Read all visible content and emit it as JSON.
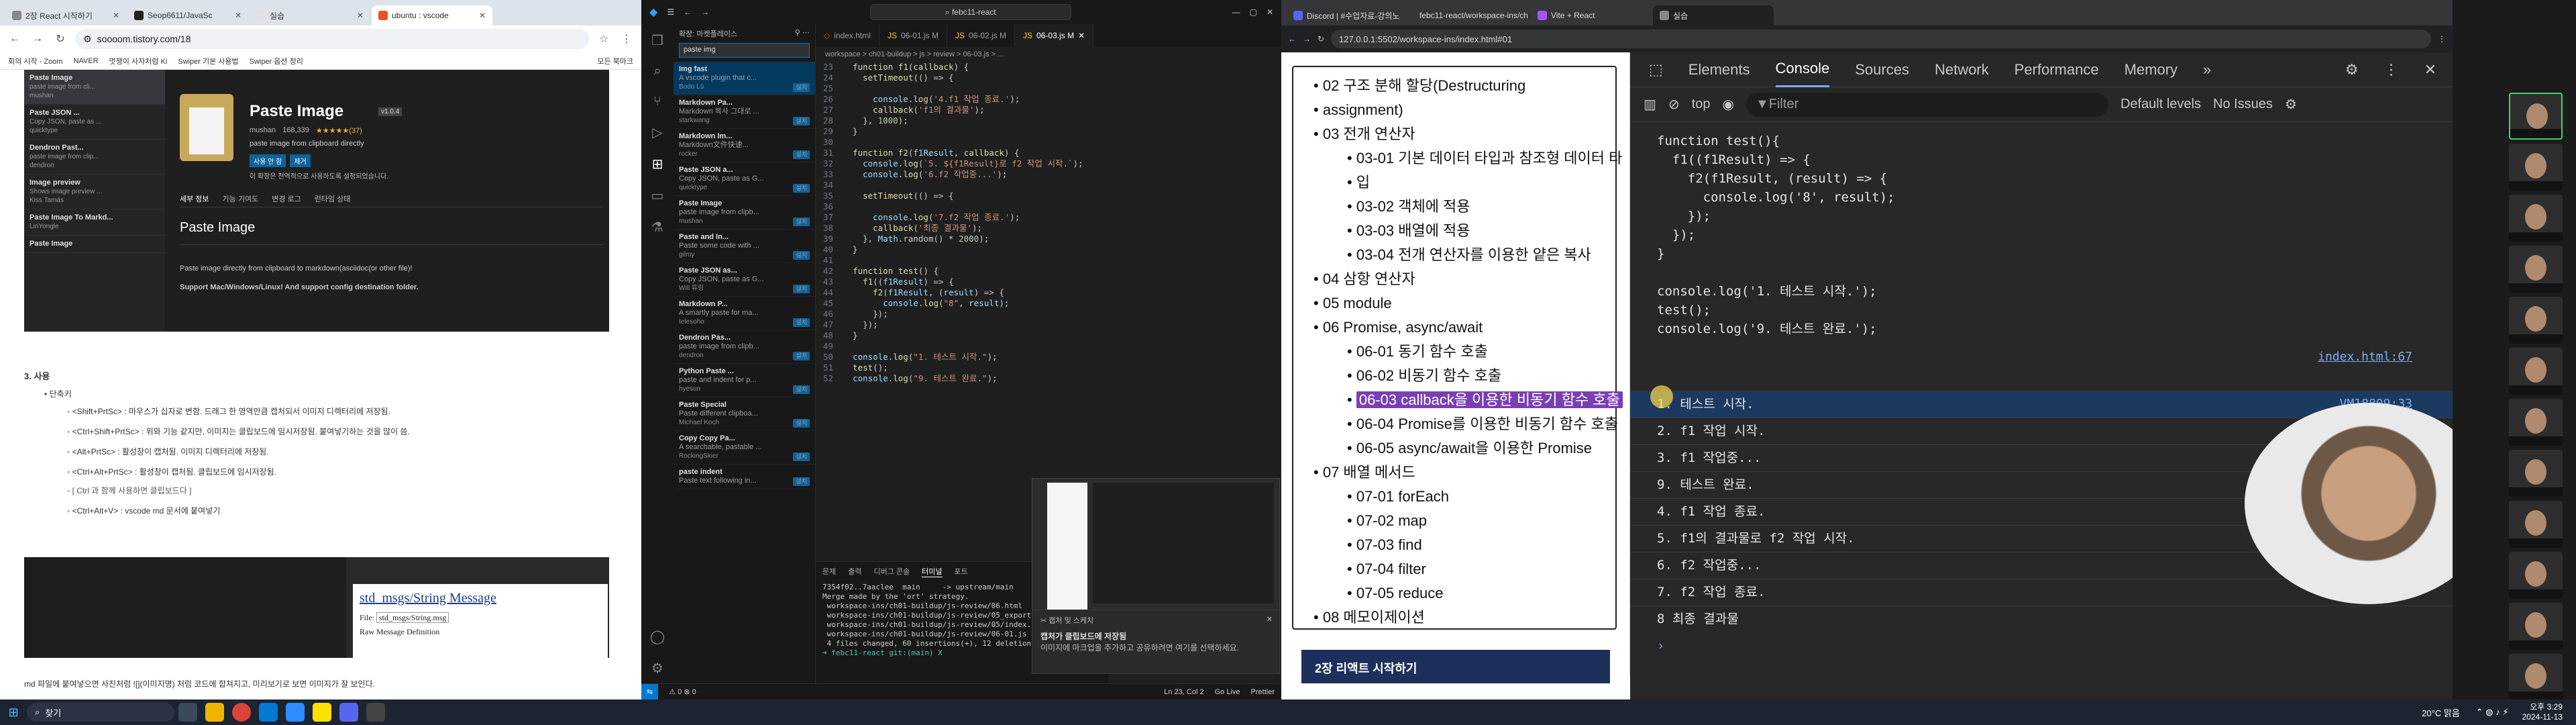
{
  "left_browser": {
    "tabs": [
      "2장 React 시작하기",
      "Seop6611/JavaSc",
      "실습",
      "ubuntu : vscode"
    ],
    "url": "soooom.tistory.com/18",
    "bookmarks": [
      "회의 시작 - Zoom",
      "NAVER",
      "멋쟁이 사자처럼 Ki",
      "Swiper 기본 사용법",
      "Swiper 옵션 정리",
      "모든 북마크"
    ],
    "ext_list": [
      {
        "name": "Paste Image",
        "desc": "paste image from cli...",
        "author": "mushan"
      },
      {
        "name": "Paste JSON ...",
        "desc": "Copy JSON, paste as ...",
        "author": "quicktype"
      },
      {
        "name": "Dendron Past...",
        "desc": "paste image from clip...",
        "author": "dendron"
      },
      {
        "name": "Image preview",
        "desc": "Shows image preview ...",
        "author": "Kiss Tamás"
      },
      {
        "name": "Paste Image To Markd...",
        "desc": "",
        "author": "LinYongle"
      },
      {
        "name": "Paste Image",
        "desc": "",
        "author": ""
      }
    ],
    "ext_detail": {
      "title": "Paste Image",
      "version": "v1.0.4",
      "publisher": "mushan",
      "installs": "168,339",
      "rating": "★★★★★(37)",
      "desc": "paste image from clipboard directly",
      "use_btn": "사용 안 함",
      "uninstall_btn": "제거",
      "enabled_note": "이 확장은 전역적으로 사용하도록 설정되었습니다.",
      "tabs": [
        "세부 정보",
        "기능 기여도",
        "변경 로그",
        "런타임 상태"
      ],
      "heading": "Paste Image",
      "line1": "Paste image directly from clipboard to markdown(asciidoc(or other file)!",
      "line2": "Support Mac/Windows/Linux! And support config destination folder."
    },
    "section_title": "3. 사용",
    "shortcut_head": "단축키",
    "shortcuts": [
      "<Shift+PrtSc> : 마우스가 십자로 변함. 드래그 한 영역만큼 캡처되서 이미지 디렉터리에 저장됨.",
      "<Ctrl+Shift+PrtSc> : 위와 기능 같지만, 이미지는 클립보드에 임시저장됨. 붙여넣기하는 것을 많이 씀.",
      "<Alt+PrtSc> : 활성창이 캡처됨. 이미지 디렉터리에 저장됨.",
      "<Ctrl+Alt+PrtSc> : 활성창이 캡처됨. 클립보드에 임시저장됨.",
      "[ Ctrl 과 함께 사용하면 클립보드다 ]",
      "<Ctrl+Alt+V> : vscode md 문서에 붙여넣기"
    ],
    "shot2": {
      "title": "std_msgs/String Message",
      "file_label": "File:",
      "file_value": "std_msgs/String.msg",
      "raw": "Raw Message Definition"
    },
    "bottom_text": "md 파일에 붙여넣으면 사진처럼 ![](이미지명) 처럼 코드에 합쳐지고, 미리보기로 보면 이미지가 잘 보인다."
  },
  "vscode": {
    "title": "febc11-react",
    "side_head": "확장: 마켓플레이스",
    "search": "paste img",
    "ext": [
      {
        "name": "Img fast",
        "desc": "A vscode plugin that c...",
        "author": "Bodo Lü"
      },
      {
        "name": "Markdown Pa...",
        "desc": "Markdown 복사 그대로 ...",
        "author": "starkwang"
      },
      {
        "name": "Markdown Im...",
        "desc": "Markdown文件快速...",
        "author": "rocker"
      },
      {
        "name": "Paste JSON a...",
        "desc": "Copy JSON, paste as G...",
        "author": "quicktype"
      },
      {
        "name": "Paste Image",
        "desc": "paste image from clipb...",
        "author": "mushan"
      },
      {
        "name": "Paste and In...",
        "desc": "Paste some code with ...",
        "author": "gilmy"
      },
      {
        "name": "Paste JSON as...",
        "desc": "Copy JSON, paste as G...",
        "author": "Will 튜링"
      },
      {
        "name": "Markdown P...",
        "desc": "A smartly paste for ma...",
        "author": "telesoho"
      },
      {
        "name": "Dendron Pas...",
        "desc": "paste image from clipb...",
        "author": "dendron"
      },
      {
        "name": "Python Paste ...",
        "desc": "paste and indent for p...",
        "author": "hyesun"
      },
      {
        "name": "Paste Special",
        "desc": "Paste different clipboa...",
        "author": "Michael Koch"
      },
      {
        "name": "Copy Copy Pa...",
        "desc": "A searchable, pastable ...",
        "author": "RockingSkier"
      },
      {
        "name": "paste indent",
        "desc": "Paste text following in...",
        "author": ""
      }
    ],
    "install_label": "설치",
    "tabs": [
      "index.html",
      "06-01.js M",
      "06-02.js M",
      "06-03.js M"
    ],
    "breadcrumb": "workspace > ch01-buildup > js > review > 06-03.js > ...",
    "code": [
      {
        "n": "",
        "t": "  function f1(callback) {"
      },
      {
        "n": "",
        "t": "    setTimeout(() => {"
      },
      {
        "n": "",
        "t": ""
      },
      {
        "n": "",
        "t": "      console.log('4.f1 작업 종료.');"
      },
      {
        "n": "",
        "t": "      callback('f1의 결과물');"
      },
      {
        "n": "",
        "t": "    }, 1000);"
      },
      {
        "n": "",
        "t": "  }"
      },
      {
        "n": "",
        "t": ""
      },
      {
        "n": "",
        "t": "  function f2(f1Result, callback) {"
      },
      {
        "n": "",
        "t": "    console.log(`5. ${f1Result}로 f2 작업 시작.`);"
      },
      {
        "n": "",
        "t": "    console.log('6.f2 작업중...');"
      },
      {
        "n": "",
        "t": ""
      },
      {
        "n": "",
        "t": "    setTimeout(() => {"
      },
      {
        "n": "",
        "t": ""
      },
      {
        "n": "",
        "t": "      console.log('7.f2 작업 종료.');"
      },
      {
        "n": "",
        "t": "      callback('최종 결과물');"
      },
      {
        "n": "",
        "t": "    }, Math.random() * 2000);"
      },
      {
        "n": "",
        "t": "  }"
      },
      {
        "n": "",
        "t": ""
      },
      {
        "n": "",
        "t": "  function test() {"
      },
      {
        "n": "",
        "t": "    f1((f1Result) => {"
      },
      {
        "n": "",
        "t": "      f2(f1Result, (result) => {"
      },
      {
        "n": "",
        "t": "        console.log(\"8\", result);"
      },
      {
        "n": "",
        "t": "      });"
      },
      {
        "n": "",
        "t": "    });"
      },
      {
        "n": "",
        "t": "  }"
      },
      {
        "n": "",
        "t": ""
      },
      {
        "n": "",
        "t": "  console.log(\"1. 테스트 시작.\");"
      },
      {
        "n": "",
        "t": "  test();"
      },
      {
        "n": "",
        "t": "  console.log(\"9. 테스트 완료.\");"
      }
    ],
    "term_tabs": [
      "문제",
      "출력",
      "디버그 콘솔",
      "터미널",
      "포트"
    ],
    "terminal": [
      "7354f02..7aaclee  main     -> upstream/main",
      "Merge made by the 'ort' strategy.",
      " workspace-ins/ch01-buildup/js-review/06.html",
      " workspace-ins/ch01-buildup/js-review/05_export.j",
      " workspace-ins/ch01-buildup/js-review/05/index.ht",
      " workspace-ins/ch01-buildup/js-review/06-01.js",
      " 4 files changed, 60 insertions(+), 12 deletions(",
      "➜ febc11-react git:(main) X"
    ],
    "notif_title": "캡처 및 스케치",
    "notif_head": "캡처가 클립보드에 저장됨",
    "notif_body": "이미지에 마크업을 추가하고 공유하려면 여기를 선택하세요.",
    "status": [
      "⚠ 0  ⊗ 0",
      "Ln 23, Col 2",
      "Go Live",
      "Prettier"
    ]
  },
  "right_browser": {
    "tabs": [
      "Discord | #수업자료-강의노",
      "febc11-react/workspace-ins/ch",
      "Vite + React",
      "실습"
    ],
    "url": "127.0.0.1:5502/workspace-ins/index.html#01",
    "toc": [
      {
        "t": "02 구조 분해 할당(Destructuring",
        "sub": false
      },
      {
        "t": "assignment)",
        "sub": false
      },
      {
        "t": "03 전개 연산자",
        "sub": false
      },
      {
        "t": "03-01 기본 데이터 타입과 참조형 데이터 타",
        "sub": true
      },
      {
        "t": "입",
        "sub": true
      },
      {
        "t": "03-02 객체에 적용",
        "sub": true
      },
      {
        "t": "03-03 배열에 적용",
        "sub": true
      },
      {
        "t": "03-04 전개 연산자를 이용한 얕은 복사",
        "sub": true
      },
      {
        "t": "04 삼항 연산자",
        "sub": false
      },
      {
        "t": "05 module",
        "sub": false
      },
      {
        "t": "06 Promise, async/await",
        "sub": false
      },
      {
        "t": "06-01 동기 함수 호출",
        "sub": true
      },
      {
        "t": "06-02 비동기 함수 호출",
        "sub": true
      },
      {
        "t": "06-03 callback을 이용한 비동기 함수 호출",
        "sub": true,
        "hl": true
      },
      {
        "t": "06-04 Promise를 이용한 비동기 함수 호출",
        "sub": true
      },
      {
        "t": "06-05 async/await을 이용한 Promise",
        "sub": true
      },
      {
        "t": "07 배열 메서드",
        "sub": false
      },
      {
        "t": "07-01 forEach",
        "sub": true
      },
      {
        "t": "07-02 map",
        "sub": true
      },
      {
        "t": "07-03 find",
        "sub": true
      },
      {
        "t": "07-04 filter",
        "sub": true
      },
      {
        "t": "07-05 reduce",
        "sub": true
      },
      {
        "t": "08 메모이제이션",
        "sub": false
      }
    ],
    "toc_bottom": "2장 리액트 시작하기",
    "dev_tabs": [
      "Elements",
      "Console",
      "Sources",
      "Network",
      "Performance",
      "Memory"
    ],
    "dev_context": "top",
    "dev_filter": "Filter",
    "dev_levels": "Default levels",
    "dev_issues": "No Issues",
    "source_lines": [
      "function test(){",
      "  f1((f1Result) => {",
      "    f2(f1Result, (result) => {",
      "      console.log('8', result);",
      "    });",
      "  });",
      "}",
      "",
      "console.log('1. 테스트 시작.');",
      "test();",
      "console.log('9. 테스트 완료.');"
    ],
    "source_link": "index.html:67",
    "logs": [
      {
        "t": "1. 테스트 시작.",
        "link": "VM18809:33"
      },
      {
        "t": "2. f1 작업 시작.",
        "link": "VM18809:3"
      },
      {
        "t": "3. f1 작업중...",
        "link": "VM18809:4"
      },
      {
        "t": "9. 테스트 완료.",
        "link": ""
      },
      {
        "t": "4. f1 작업 종료.",
        "link": ""
      },
      {
        "t": "5. f1의 결과물로 f2 작업 시작.",
        "link": ""
      },
      {
        "t": "6. f2 작업중...",
        "link": ""
      },
      {
        "t": "7. f2 작업 종료.",
        "link": ""
      },
      {
        "t": "8 최종 결과물",
        "link": ""
      }
    ]
  },
  "participants": [
    {
      "name": ""
    },
    {
      "name": ""
    },
    {
      "name": ""
    },
    {
      "name": ""
    },
    {
      "name": ""
    },
    {
      "name": ""
    },
    {
      "name": ""
    },
    {
      "name": ""
    },
    {
      "name": ""
    },
    {
      "name": ""
    },
    {
      "name": ""
    },
    {
      "name": ""
    }
  ],
  "taskbar": {
    "search": "찾기",
    "weather": "20°C 맑음",
    "time": "오후 3:29",
    "date": "2024-11-13"
  }
}
